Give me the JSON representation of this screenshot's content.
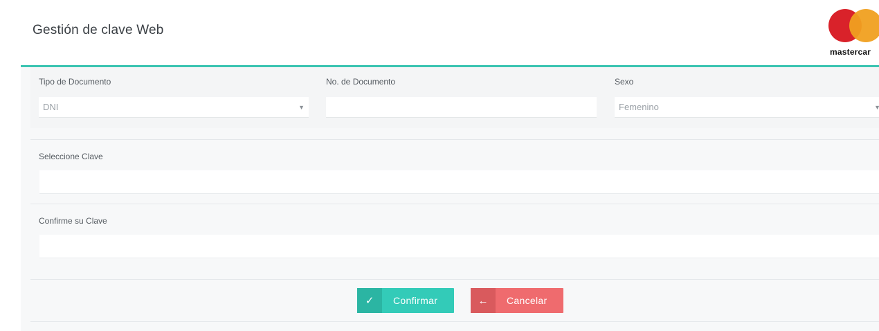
{
  "header": {
    "title": "Gestión de clave Web",
    "logo_text": "mastercar"
  },
  "form": {
    "tipo_documento": {
      "label": "Tipo de Documento",
      "value": "DNI"
    },
    "numero_documento": {
      "label": "No. de Documento",
      "value": ""
    },
    "sexo": {
      "label": "Sexo",
      "value": "Femenino"
    },
    "clave": {
      "label": "Seleccione Clave",
      "value": ""
    },
    "confirmar_clave": {
      "label": "Confirme su Clave",
      "value": ""
    }
  },
  "actions": {
    "confirm_label": "Confirmar",
    "confirm_icon": "✓",
    "cancel_label": "Cancelar",
    "cancel_icon": "←"
  },
  "colors": {
    "accent": "#3bc4b2",
    "confirm": "#33cbb8",
    "cancel": "#ef6b6e"
  }
}
